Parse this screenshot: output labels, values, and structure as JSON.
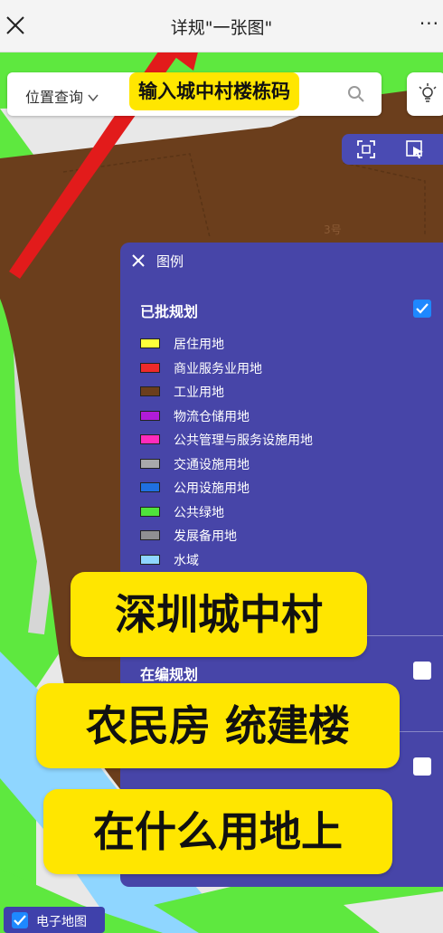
{
  "header": {
    "title": "详规\"一张图\"",
    "more_glyph": "···"
  },
  "search": {
    "location_select": "位置查询",
    "highlight_label": "输入城中村楼栋码"
  },
  "legend": {
    "title": "图例",
    "approved_section": "已批规划",
    "approved_checked": true,
    "items": [
      {
        "label": "居住用地",
        "color": "#ffff3a"
      },
      {
        "label": "商业服务业用地",
        "color": "#ee2a2a"
      },
      {
        "label": "工业用地",
        "color": "#6b3e1c"
      },
      {
        "label": "物流仓储用地",
        "color": "#b01bd8"
      },
      {
        "label": "公共管理与服务设施用地",
        "color": "#ff2bbc"
      },
      {
        "label": "交通设施用地",
        "color": "#a9a9ab"
      },
      {
        "label": "公用设施用地",
        "color": "#1f6fe0"
      },
      {
        "label": "公共绿地",
        "color": "#4fe23b"
      },
      {
        "label": "发展备用地",
        "color": "#8f8f92"
      },
      {
        "label": "水域",
        "color": "#8fd6ff"
      }
    ],
    "editing_section": "在编规划",
    "editing_checked": false,
    "third_checked": false
  },
  "captions": {
    "line1": "深圳城中村",
    "line2": "农民房 统建楼",
    "line3": "在什么用地上"
  },
  "map_labels": {
    "building_no": "3号"
  },
  "basemap": {
    "label": "电子地图",
    "checked": true
  },
  "colors": {
    "industrial": "#6b3e1c",
    "green": "#5ee83f",
    "panel": "#4745a8",
    "caption_bg": "#ffe600"
  }
}
